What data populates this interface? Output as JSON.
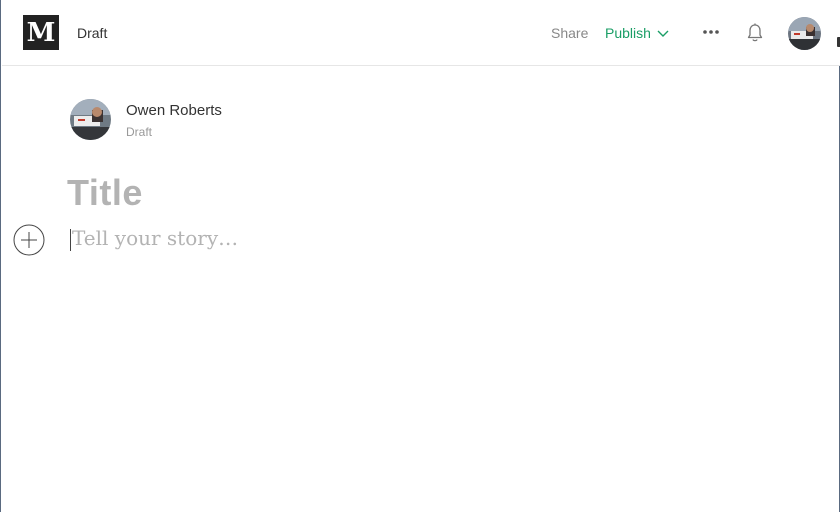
{
  "header": {
    "logo_letter": "M",
    "status": "Draft",
    "share_label": "Share",
    "publish_label": "Publish",
    "accent_color": "#1a9e66"
  },
  "icons": {
    "logo": "medium-logo-icon",
    "publish_chevron": "chevron-down-icon",
    "more": "more-horizontal-icon",
    "notifications": "bell-icon",
    "add": "plus-circle-icon"
  },
  "author": {
    "name": "Owen Roberts",
    "status": "Draft"
  },
  "editor": {
    "title_placeholder": "Title",
    "body_placeholder": "Tell your story…"
  }
}
